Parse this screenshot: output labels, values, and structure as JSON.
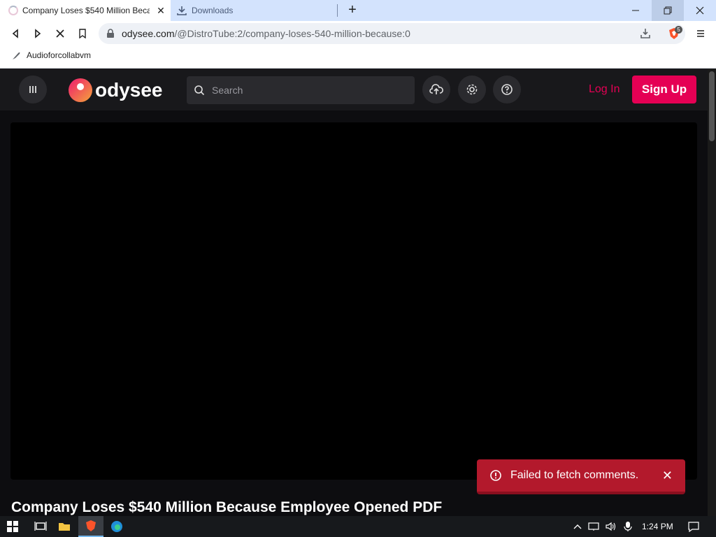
{
  "browser": {
    "tabs": [
      {
        "title": "Company Loses $540 Million Because Employee Opened PDF",
        "active": true
      },
      {
        "title": "Downloads",
        "active": false
      }
    ],
    "address_host": "odysee.com",
    "address_path": "/@DistroTube:2/company-loses-540-million-because:0",
    "bookmark_label": "Audioforcollabvm",
    "shields_badge": "5"
  },
  "site": {
    "logo_text": "odysee",
    "search_placeholder": "Search",
    "login_label": "Log In",
    "signup_label": "Sign Up",
    "video_title": "Company Loses $540 Million Because Employee Opened PDF",
    "toast_message": "Failed to fetch comments."
  },
  "taskbar": {
    "clock": "1:24 PM"
  },
  "colors": {
    "brand_pink": "#e50054",
    "toast_red": "#b3192c",
    "tabstrip_blue": "#d3e3fd"
  }
}
